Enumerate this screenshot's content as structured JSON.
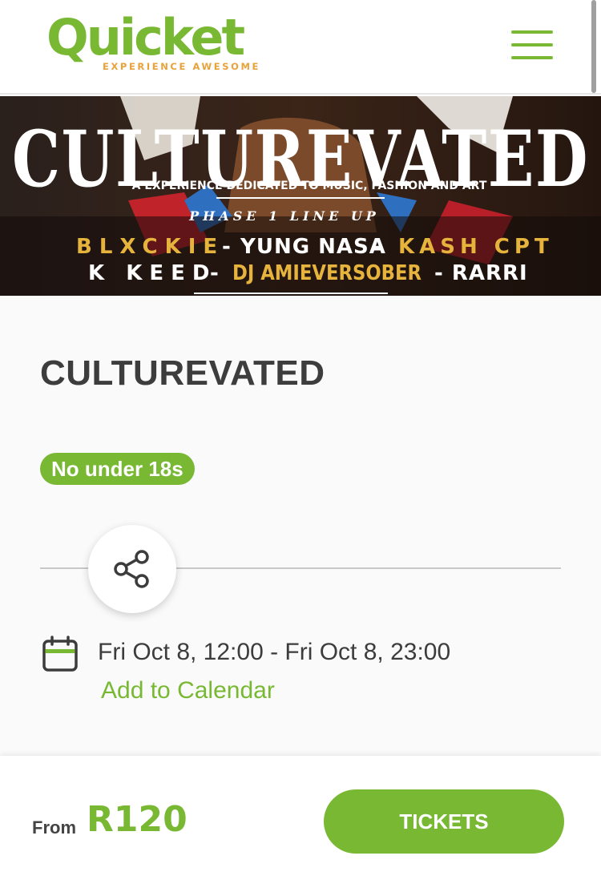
{
  "header": {
    "logo_text": "Quicket",
    "logo_tagline": "EXPERIENCE AWESOME",
    "menu_icon": "hamburger-menu-icon"
  },
  "banner": {
    "headline": "CULTUREVATED",
    "subline": "A EXPERIENCE DEDICATED TO MUSIC, FASHION AND ART",
    "phase": "PHASE 1 LINE UP",
    "lineup": {
      "a1": "BLXCKIE",
      "s1": "-",
      "a2": "YUNG NASA",
      "s2": "-",
      "a3": "KASH CPT",
      "a4": "K KEED",
      "s3": "-",
      "a5": "DJ AMIEVERSOBER",
      "s4": "- RARRI"
    }
  },
  "event": {
    "title": "CULTUREVATED",
    "age_badge": "No under 18s",
    "share_icon": "share-icon",
    "calendar_icon": "calendar-icon",
    "date_range": "Fri Oct 8, 12:00 - Fri Oct 8, 23:00",
    "add_to_calendar": "Add to Calendar"
  },
  "footer": {
    "from_label": "From",
    "price": "R120",
    "tickets_label": "TICKETS"
  },
  "colors": {
    "brand_green": "#78b833",
    "brand_orange": "#e8a23a",
    "banner_yellow": "#e6b43c",
    "text_dark": "#3c3c3c"
  }
}
